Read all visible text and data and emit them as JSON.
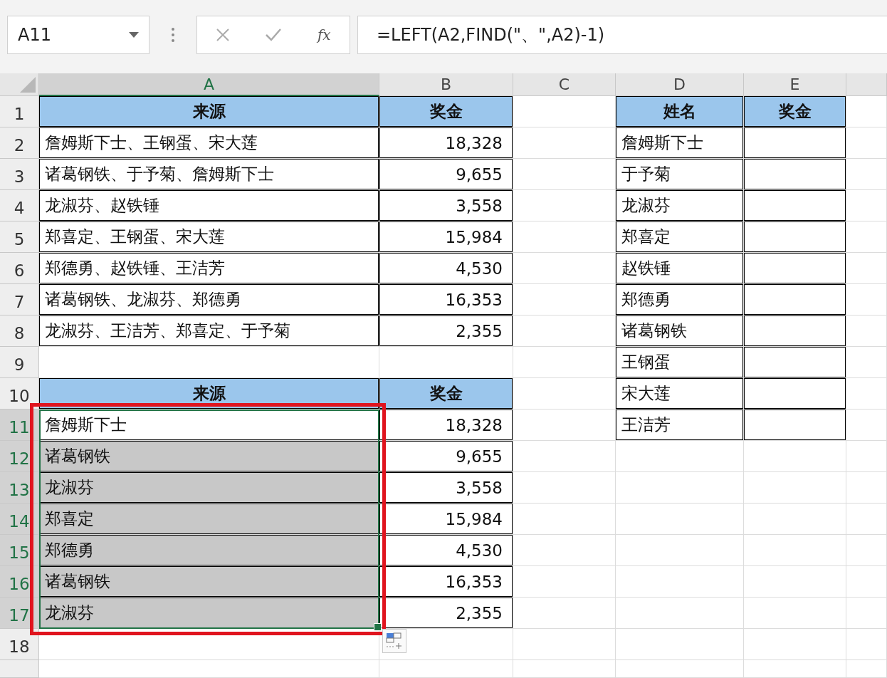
{
  "name_box": {
    "value": "A11"
  },
  "formula_bar": {
    "function_label": "fx",
    "formula": "=LEFT(A2,FIND(\"、\",A2)-1)"
  },
  "columns": [
    {
      "label": "A",
      "selected": true
    },
    {
      "label": "B",
      "selected": false
    },
    {
      "label": "C",
      "selected": false
    },
    {
      "label": "D",
      "selected": false
    },
    {
      "label": "E",
      "selected": false
    }
  ],
  "rows": [
    {
      "label": "1",
      "selected": false,
      "cells": [
        {
          "kind": "header",
          "text": "来源"
        },
        {
          "kind": "header",
          "text": "奖金"
        },
        {
          "kind": "empty"
        },
        {
          "kind": "header",
          "text": "姓名"
        },
        {
          "kind": "header",
          "text": "奖金"
        }
      ]
    },
    {
      "label": "2",
      "selected": false,
      "cells": [
        {
          "kind": "text",
          "text": "詹姆斯下士、王钢蛋、宋大莲"
        },
        {
          "kind": "number",
          "text": "18,328"
        },
        {
          "kind": "empty"
        },
        {
          "kind": "text",
          "text": "詹姆斯下士"
        },
        {
          "kind": "blank"
        }
      ]
    },
    {
      "label": "3",
      "selected": false,
      "cells": [
        {
          "kind": "text",
          "text": "诸葛钢铁、于予菊、詹姆斯下士"
        },
        {
          "kind": "number",
          "text": "9,655"
        },
        {
          "kind": "empty"
        },
        {
          "kind": "text",
          "text": "于予菊"
        },
        {
          "kind": "blank"
        }
      ]
    },
    {
      "label": "4",
      "selected": false,
      "cells": [
        {
          "kind": "text",
          "text": "龙淑芬、赵铁锤"
        },
        {
          "kind": "number",
          "text": "3,558"
        },
        {
          "kind": "empty"
        },
        {
          "kind": "text",
          "text": "龙淑芬"
        },
        {
          "kind": "blank"
        }
      ]
    },
    {
      "label": "5",
      "selected": false,
      "cells": [
        {
          "kind": "text",
          "text": "郑喜定、王钢蛋、宋大莲"
        },
        {
          "kind": "number",
          "text": "15,984"
        },
        {
          "kind": "empty"
        },
        {
          "kind": "text",
          "text": "郑喜定"
        },
        {
          "kind": "blank"
        }
      ]
    },
    {
      "label": "6",
      "selected": false,
      "cells": [
        {
          "kind": "text",
          "text": "郑德勇、赵铁锤、王洁芳"
        },
        {
          "kind": "number",
          "text": "4,530"
        },
        {
          "kind": "empty"
        },
        {
          "kind": "text",
          "text": "赵铁锤"
        },
        {
          "kind": "blank"
        }
      ]
    },
    {
      "label": "7",
      "selected": false,
      "cells": [
        {
          "kind": "text",
          "text": "诸葛钢铁、龙淑芬、郑德勇"
        },
        {
          "kind": "number",
          "text": "16,353"
        },
        {
          "kind": "empty"
        },
        {
          "kind": "text",
          "text": "郑德勇"
        },
        {
          "kind": "blank"
        }
      ]
    },
    {
      "label": "8",
      "selected": false,
      "cells": [
        {
          "kind": "text",
          "text": "龙淑芬、王洁芳、郑喜定、于予菊"
        },
        {
          "kind": "number",
          "text": "2,355"
        },
        {
          "kind": "empty"
        },
        {
          "kind": "text",
          "text": "诸葛钢铁"
        },
        {
          "kind": "blank"
        }
      ]
    },
    {
      "label": "9",
      "selected": false,
      "cells": [
        {
          "kind": "empty"
        },
        {
          "kind": "empty"
        },
        {
          "kind": "empty"
        },
        {
          "kind": "text",
          "text": "王钢蛋"
        },
        {
          "kind": "blank"
        }
      ]
    },
    {
      "label": "10",
      "selected": false,
      "cells": [
        {
          "kind": "header",
          "text": "来源"
        },
        {
          "kind": "header",
          "text": "奖金"
        },
        {
          "kind": "empty"
        },
        {
          "kind": "text",
          "text": "宋大莲"
        },
        {
          "kind": "blank"
        }
      ]
    },
    {
      "label": "11",
      "selected": true,
      "cells": [
        {
          "kind": "text",
          "text": "詹姆斯下士",
          "selected": true,
          "active": true
        },
        {
          "kind": "number",
          "text": "18,328"
        },
        {
          "kind": "empty"
        },
        {
          "kind": "text",
          "text": "王洁芳"
        },
        {
          "kind": "blank"
        }
      ]
    },
    {
      "label": "12",
      "selected": true,
      "cells": [
        {
          "kind": "text",
          "text": "诸葛钢铁",
          "selected": true,
          "active": false
        },
        {
          "kind": "number",
          "text": "9,655"
        }
      ]
    },
    {
      "label": "13",
      "selected": true,
      "cells": [
        {
          "kind": "text",
          "text": "龙淑芬",
          "selected": true,
          "active": false
        },
        {
          "kind": "number",
          "text": "3,558"
        }
      ]
    },
    {
      "label": "14",
      "selected": true,
      "cells": [
        {
          "kind": "text",
          "text": "郑喜定",
          "selected": true,
          "active": false
        },
        {
          "kind": "number",
          "text": "15,984"
        }
      ]
    },
    {
      "label": "15",
      "selected": true,
      "cells": [
        {
          "kind": "text",
          "text": "郑德勇",
          "selected": true,
          "active": false
        },
        {
          "kind": "number",
          "text": "4,530"
        }
      ]
    },
    {
      "label": "16",
      "selected": true,
      "cells": [
        {
          "kind": "text",
          "text": "诸葛钢铁",
          "selected": true,
          "active": false
        },
        {
          "kind": "number",
          "text": "16,353"
        }
      ]
    },
    {
      "label": "17",
      "selected": true,
      "cells": [
        {
          "kind": "text",
          "text": "龙淑芬",
          "selected": true,
          "active": false
        },
        {
          "kind": "number",
          "text": "2,355"
        }
      ]
    },
    {
      "label": "18",
      "selected": false,
      "cells": []
    },
    {
      "selected": false,
      "cells": []
    }
  ]
}
